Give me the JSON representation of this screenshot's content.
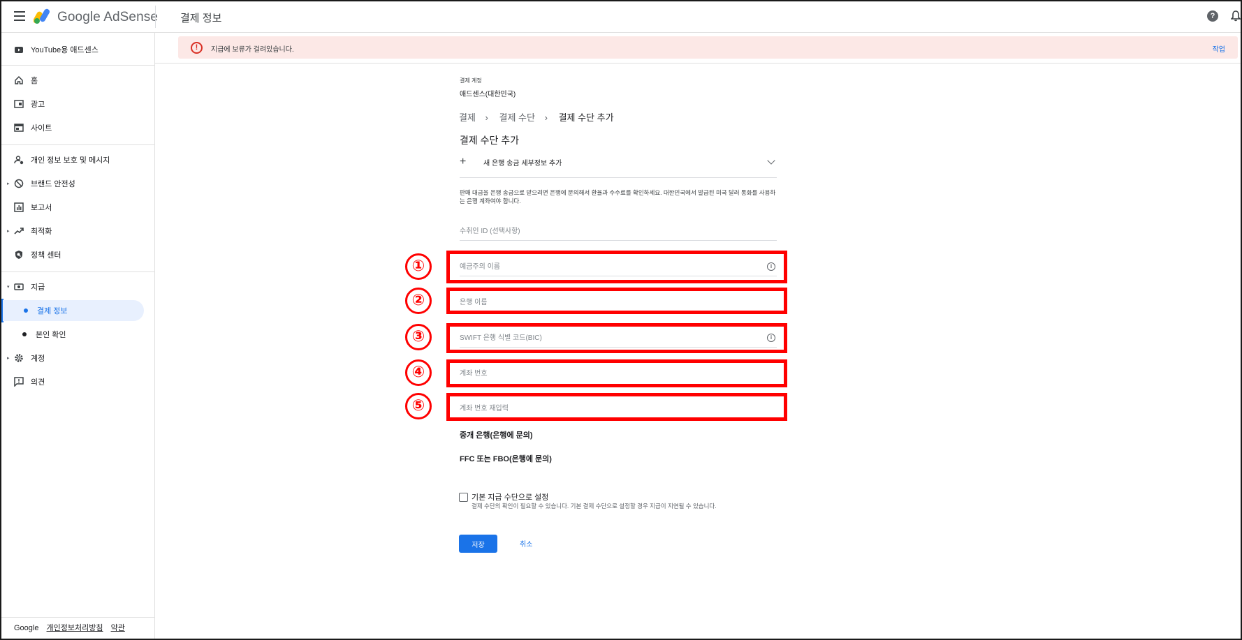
{
  "topbar": {
    "brand_google": "Google",
    "brand_product": "AdSense",
    "page_title": "결제 정보",
    "help_glyph": "?"
  },
  "sidebar": {
    "youtube": "YouTube용 애드센스",
    "items": [
      {
        "label": "홈",
        "icon": "home-icon"
      },
      {
        "label": "광고",
        "icon": "ads-icon"
      },
      {
        "label": "사이트",
        "icon": "sites-icon"
      },
      {
        "label": "개인 정보 보호 및 메시지",
        "icon": "privacy-icon"
      },
      {
        "label": "브랜드 안전성",
        "icon": "block-icon"
      },
      {
        "label": "보고서",
        "icon": "reports-icon"
      },
      {
        "label": "최적화",
        "icon": "trend-icon"
      },
      {
        "label": "정책 센터",
        "icon": "policy-icon"
      },
      {
        "label": "지급",
        "icon": "payments-icon"
      },
      {
        "label": "결제 정보",
        "icon": "dot"
      },
      {
        "label": "본인 확인",
        "icon": "dot"
      },
      {
        "label": "계정",
        "icon": "gear-icon"
      },
      {
        "label": "의견",
        "icon": "feedback-icon"
      }
    ],
    "footer": {
      "google": "Google",
      "privacy": "개인정보처리방침",
      "terms": "약관"
    }
  },
  "banner": {
    "icon_glyph": "!",
    "message": "지급에 보류가 걸려있습니다.",
    "action": "작업"
  },
  "form": {
    "account_label": "결제 계정",
    "account_value": "애드센스(대한민국)",
    "breadcrumb": [
      "결제",
      "결제 수단",
      "결제 수단 추가"
    ],
    "breadcrumb_sep": "›",
    "section_title": "결제 수단 추가",
    "new_bank_plus": "+",
    "new_bank_label": "새 은행 송금 세부정보 추가",
    "description": "판매 대금을 은행 송금으로 받으려면 은행에 문의해서 환율과 수수료를 확인하세요. 대한민국에서 발급된 미국 달러 통화를 사용하는 은행 계좌여야 합니다.",
    "payee_id_placeholder": "수취인 ID (선택사항)",
    "holder_name_placeholder": "예금주의 이름",
    "bank_name_placeholder": "은행 이름",
    "swift_placeholder": "SWIFT 은행 식별 코드(BIC)",
    "account_number_placeholder": "계좌 번호",
    "account_number_confirm_placeholder": "계좌 번호 재입력",
    "info_glyph": "i",
    "intermediary_bank": "중개 은행(은행에 문의)",
    "ffc_fbo": "FFC 또는 FBO(은행에 문의)",
    "default_checkbox_label": "기본 지급 수단으로 설정",
    "default_checkbox_sub": "결제 수단의 확인이 필요할 수 있습니다. 기본 결제 수단으로 설정할 경우 지급이 지연될 수 있습니다.",
    "save": "저장",
    "cancel": "취소"
  },
  "annotations": [
    "①",
    "②",
    "③",
    "④",
    "⑤"
  ],
  "colors": {
    "accent": "#1a73e8",
    "error": "#d93025",
    "banner_bg": "#fce8e6",
    "annotation_red": "#ff0000"
  }
}
